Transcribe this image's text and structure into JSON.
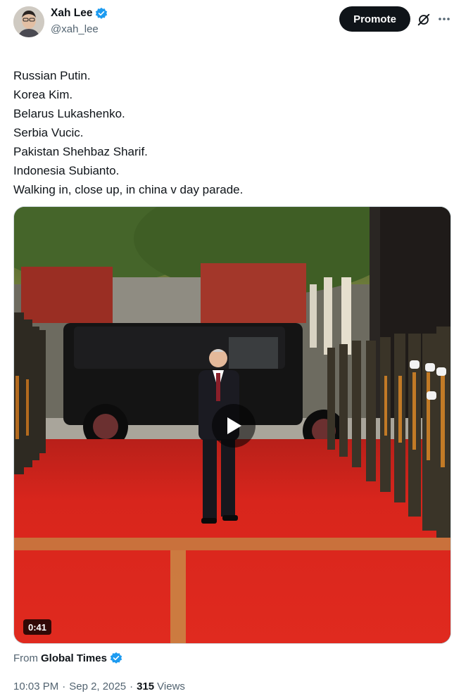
{
  "author": {
    "display_name": "Xah Lee",
    "handle": "@xah_lee",
    "verified_icon": "verified-badge-icon",
    "verified_color": "#1d9bf0"
  },
  "actions": {
    "promote_label": "Promote",
    "grok_icon": "grok-icon",
    "more_icon": "more-options-icon"
  },
  "tweet": {
    "lines": [
      "Russian Putin.",
      "Korea Kim.",
      "Belarus Lukashenko.",
      "Serbia Vucic.",
      "Pakistan Shehbaz Sharif.",
      "Indonesia Subianto.",
      "Walking in, close up, in china v day parade."
    ]
  },
  "media": {
    "type": "video",
    "duration": "0:41",
    "play_icon": "play-icon",
    "from_label": "From",
    "source_name": "Global Times",
    "source_verified_color": "#1d9bf0"
  },
  "meta": {
    "time": "10:03 PM",
    "separator": "·",
    "date": "Sep 2, 2025",
    "views_count": "315",
    "views_label": "Views"
  },
  "colors": {
    "text_primary": "#0f1419",
    "text_secondary": "#536471",
    "accent": "#1d9bf0",
    "carpet": "#d8251c"
  }
}
